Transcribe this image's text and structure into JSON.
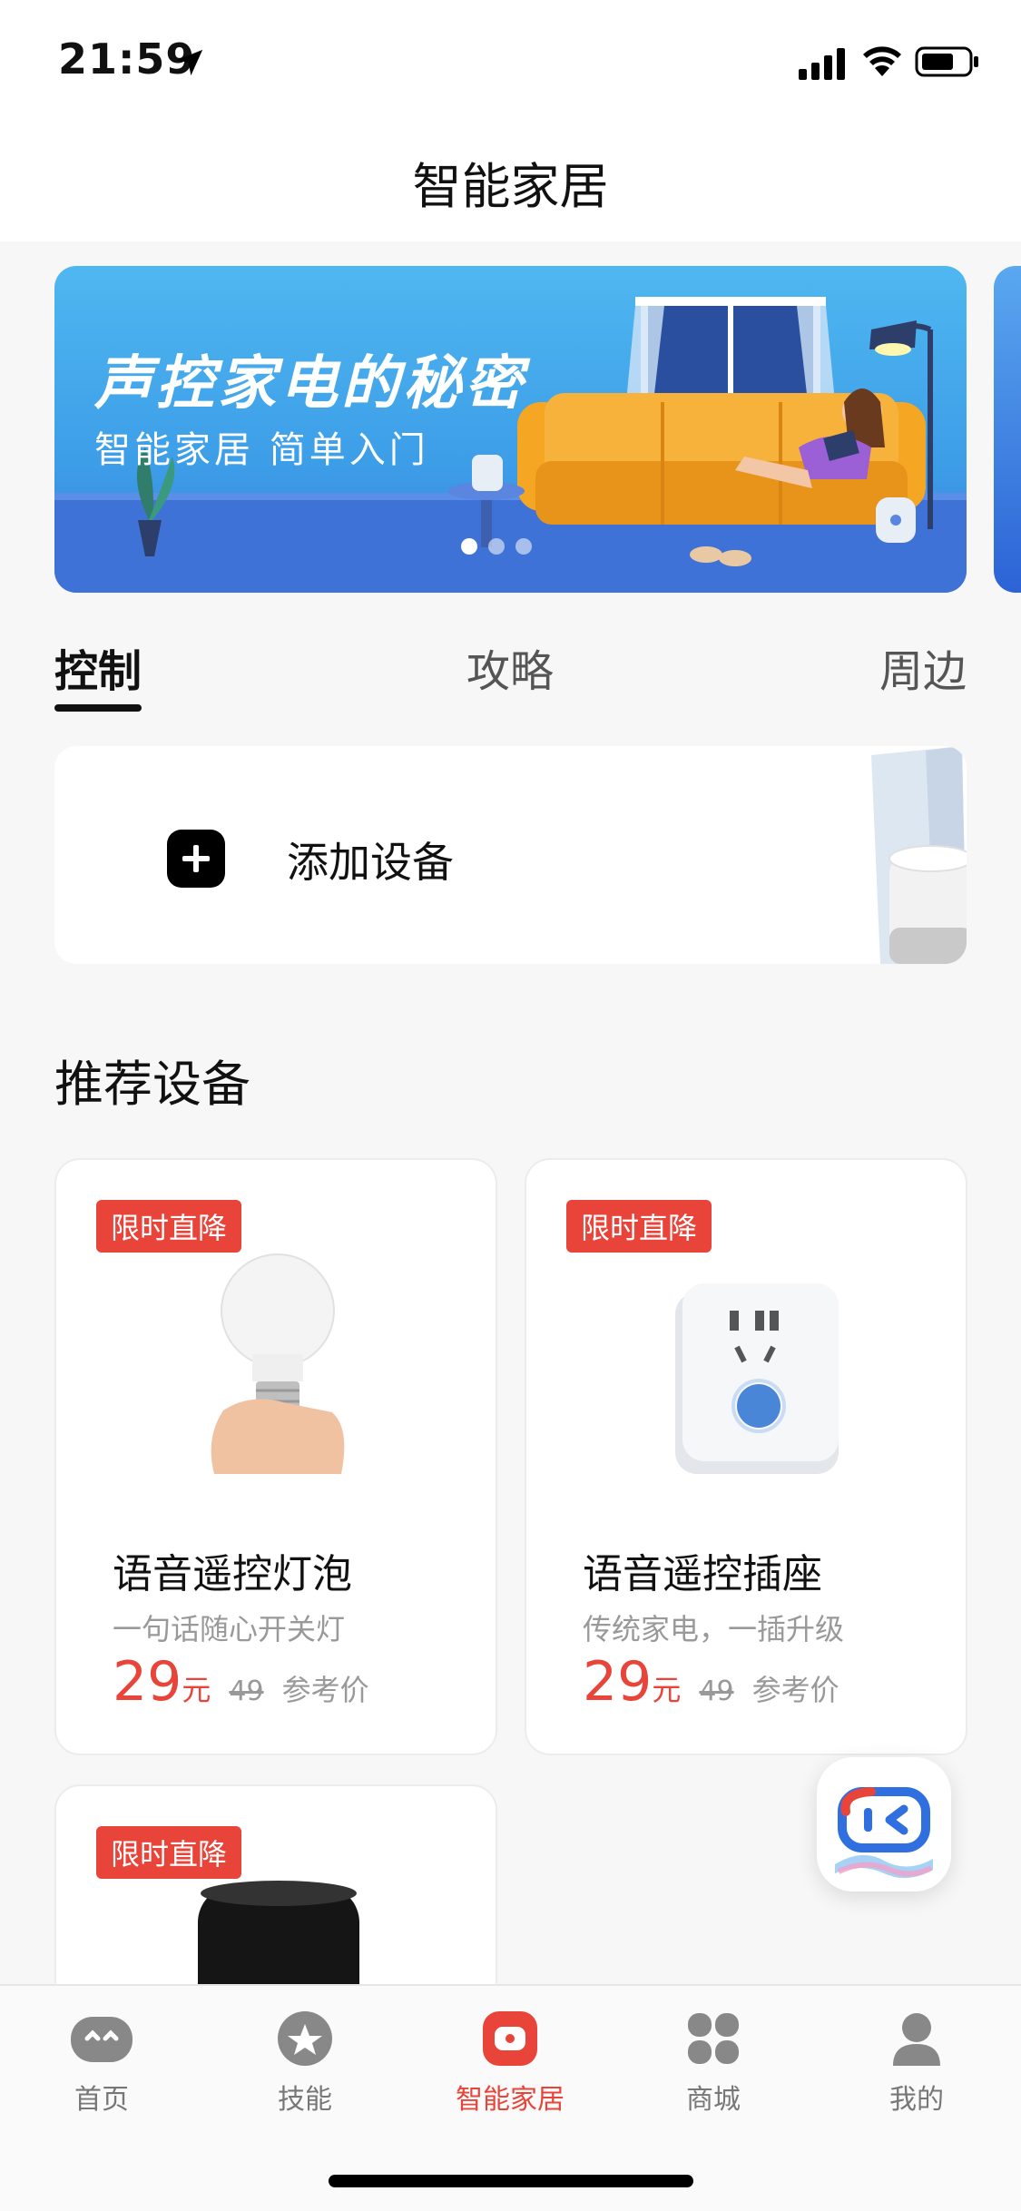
{
  "status_bar": {
    "time": "21:59"
  },
  "header": {
    "title": "智能家居"
  },
  "banner": {
    "title": "声控家电的秘密",
    "subtitle": "智能家居 简单入门",
    "dots_total": 3,
    "active_dot": 1
  },
  "tabs": [
    {
      "label": "控制",
      "active": true
    },
    {
      "label": "攻略",
      "active": false
    },
    {
      "label": "周边",
      "active": false
    }
  ],
  "add_device": {
    "label": "添加设备"
  },
  "section": {
    "title": "推荐设备"
  },
  "products": [
    {
      "badge": "限时直降",
      "name": "语音遥控灯泡",
      "desc": "一句话随心开关灯",
      "price": "29",
      "unit": "元",
      "old_price": "49",
      "ref_label": "参考价"
    },
    {
      "badge": "限时直降",
      "name": "语音遥控插座",
      "desc": "传统家电，一插升级",
      "price": "29",
      "unit": "元",
      "old_price": "49",
      "ref_label": "参考价"
    },
    {
      "badge": "限时直降"
    }
  ],
  "tabbar": {
    "items": [
      {
        "label": "首页",
        "icon": "home-face-icon",
        "active": false
      },
      {
        "label": "技能",
        "icon": "star-icon",
        "active": false
      },
      {
        "label": "智能家居",
        "icon": "smart-home-icon",
        "active": true
      },
      {
        "label": "商城",
        "icon": "grid-icon",
        "active": false
      },
      {
        "label": "我的",
        "icon": "person-icon",
        "active": false
      }
    ]
  },
  "colors": {
    "accent": "#e8443a",
    "banner_blue": "#4fb7f0",
    "sofa": "#f5a623"
  }
}
